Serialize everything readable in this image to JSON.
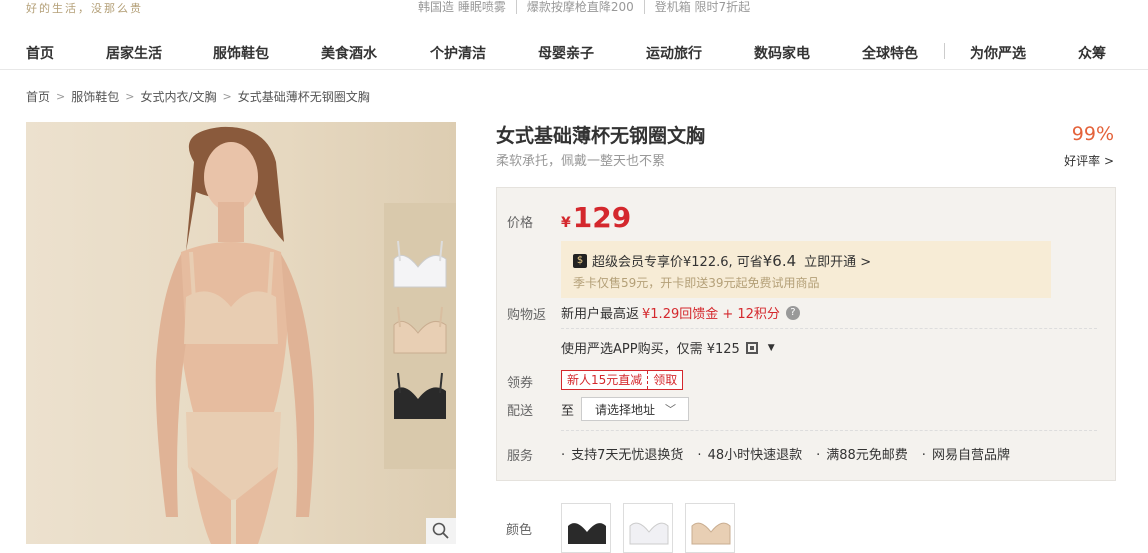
{
  "topbar": {
    "slogan": "好的生活，没那么贵",
    "promos": [
      "韩国造 睡眠喷雾",
      "爆款按摩枪直降200",
      "登机箱 限时7折起"
    ]
  },
  "nav": {
    "items": [
      "首页",
      "居家生活",
      "服饰鞋包",
      "美食酒水",
      "个护清洁",
      "母婴亲子",
      "运动旅行",
      "数码家电",
      "全球特色",
      "为你严选",
      "众筹"
    ]
  },
  "breadcrumb": [
    "首页",
    "服饰鞋包",
    "女式内衣/文胸",
    "女式基础薄杯无钢圈文胸"
  ],
  "product": {
    "title": "女式基础薄杯无钢圈文胸",
    "subtitle": "柔软承托，佩戴一整天也不累",
    "rating_value": "99%",
    "rating_label": "好评率 >",
    "thumb_colors": [
      "#f4f4f6",
      "#e8cfb4",
      "#2a2a2a"
    ]
  },
  "price_box": {
    "price_label": "价格",
    "currency": "¥",
    "price": "129",
    "vip_text": "超级会员专享价¥122.6, 可省",
    "vip_save": "¥6.4",
    "vip_open": "立即开通 >",
    "vip_sub": "季卡仅售59元，开卡即送39元起免费试用商品",
    "rebate_label": "购物返",
    "rebate_text": "新用户最高返",
    "rebate_red": "¥1.29回馈金 + 12积分",
    "app_text": "使用严选APP购买，仅需 ¥125",
    "coupon_label": "领券",
    "coupon_text": "新人15元直减",
    "coupon_get": "领取",
    "ship_label": "配送",
    "ship_to": "至",
    "address_placeholder": "请选择地址",
    "service_label": "服务",
    "services": [
      "支持7天无忧退换货",
      "48小时快速退款",
      "满88元免邮费",
      "网易自营品牌"
    ]
  },
  "color": {
    "label": "颜色",
    "swatches": [
      "#2a2a2a",
      "#f0f0f4",
      "#e8cfb4"
    ]
  }
}
